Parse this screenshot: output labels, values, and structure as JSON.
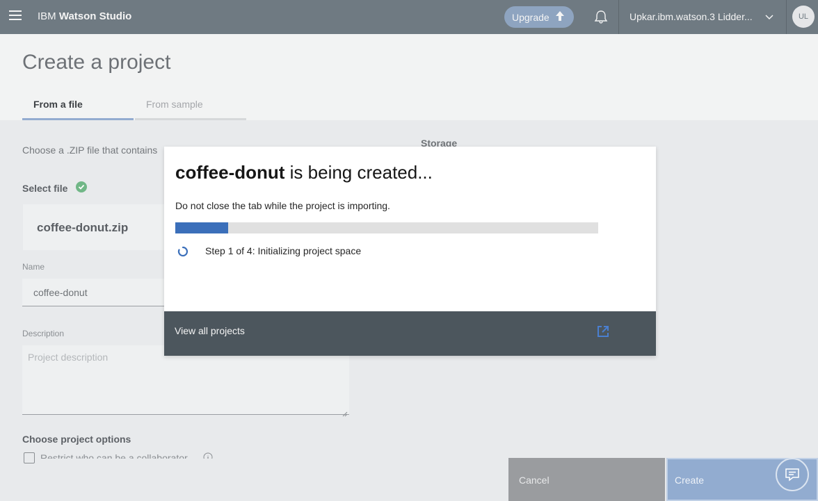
{
  "header": {
    "brand_prefix": "IBM",
    "brand_name": "Watson Studio",
    "upgrade_label": "Upgrade",
    "account_label": "Upkar.ibm.watson.3 Lidder...",
    "avatar_initials": "UL"
  },
  "page": {
    "title": "Create a project",
    "tabs": [
      {
        "label": "From a file",
        "selected": true
      },
      {
        "label": "From sample",
        "selected": false
      }
    ],
    "choose_text": "Choose a .ZIP file that contains",
    "storage_label": "Storage",
    "select_file_label": "Select file",
    "file_name": "coffee-donut.zip",
    "name_label": "Name",
    "name_value": "coffee-donut",
    "description_label": "Description",
    "description_placeholder": "Project description",
    "options_label": "Choose project options",
    "restrict_option": "Restrict who can be a collaborator"
  },
  "footer": {
    "cancel_label": "Cancel",
    "create_label": "Create"
  },
  "modal": {
    "project_name": "coffee-donut",
    "title_suffix": " is being created...",
    "subtitle": "Do not close the tab while the project is importing.",
    "progress_percent": 12.5,
    "step_text": "Step 1 of 4: Initializing project space",
    "view_all_label": "View all projects"
  },
  "colors": {
    "header_bg": "#6f7a82",
    "progress_fill": "#3b6fba",
    "modal_footer_bg": "#4c565d",
    "success_green": "#71b787"
  },
  "icons": [
    "hamburger-icon",
    "upload-arrow-icon",
    "bell-icon",
    "chevron-down-icon",
    "checkmark-icon",
    "info-icon",
    "spinner-icon",
    "launch-icon",
    "chat-icon"
  ]
}
